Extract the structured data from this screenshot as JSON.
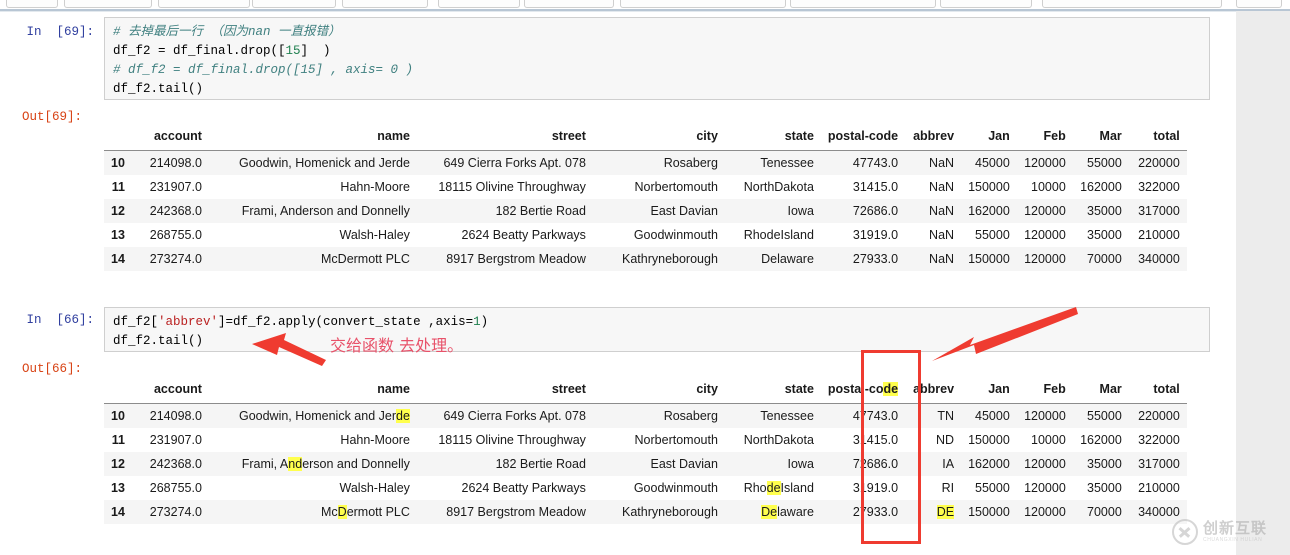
{
  "toolbar": {
    "label": "jupyter-toolbar-sliver"
  },
  "cells": [
    {
      "prompt_in": "In  [69]:",
      "prompt_out": "Out[69]:",
      "code_lines": [
        {
          "segments": [
            {
              "text": "# 去掉最后一行 （因为nan 一直报错）",
              "style": "cmt"
            }
          ]
        },
        {
          "segments": [
            {
              "text": "df_f2 = df_final.drop([",
              "style": ""
            },
            {
              "text": "15",
              "style": "num"
            },
            {
              "text": "]  )",
              "style": ""
            }
          ]
        },
        {
          "segments": [
            {
              "text": "# df_f2 = df_final.drop([15] , axis= 0 )",
              "style": "cmt"
            }
          ]
        },
        {
          "segments": [
            {
              "text": "df_f2.tail()",
              "style": ""
            }
          ]
        }
      ]
    },
    {
      "prompt_in": "In  [66]:",
      "prompt_out": "Out[66]:",
      "code_lines": [
        {
          "segments": [
            {
              "text": "df_f2[",
              "style": ""
            },
            {
              "text": "'abbrev'",
              "style": "str"
            },
            {
              "text": "]=df_f2.apply(convert_state ,axis=",
              "style": ""
            },
            {
              "text": "1",
              "style": "num"
            },
            {
              "text": ")",
              "style": ""
            }
          ]
        },
        {
          "segments": [
            {
              "text": "df_f2.tail()",
              "style": ""
            }
          ]
        }
      ]
    }
  ],
  "table": {
    "headers": [
      "",
      "account",
      "name",
      "street",
      "city",
      "state",
      "postal-code",
      "abbrev",
      "Jan",
      "Feb",
      "Mar",
      "total"
    ],
    "header_postal_code_plain": "postal-co",
    "header_postal_code_hl": "de",
    "rows": [
      {
        "index": "10",
        "account": "214098.0",
        "name": "Goodwin, Homenick and Jerde",
        "name_plain": "Goodwin, Homenick and Jer",
        "name_hl": "de",
        "name_tail": "",
        "street": "649 Cierra Forks Apt. 078",
        "city": "Rosaberg",
        "state": "Tenessee",
        "state_plain": "Tenessee",
        "state_hl": "",
        "state_tail": "",
        "postal_code": "47743.0",
        "abbrev_before": "NaN",
        "abbrev_after": "TN",
        "abbrev_hl": false,
        "jan": "45000",
        "feb": "120000",
        "mar": "55000",
        "total": "220000"
      },
      {
        "index": "11",
        "account": "231907.0",
        "name": "Hahn-Moore",
        "name_plain": "Hahn-Moore",
        "name_hl": "",
        "name_tail": "",
        "street": "18115 Olivine Throughway",
        "city": "Norbertomouth",
        "state": "NorthDakota",
        "state_plain": "NorthDakota",
        "state_hl": "",
        "state_tail": "",
        "postal_code": "31415.0",
        "abbrev_before": "NaN",
        "abbrev_after": "ND",
        "abbrev_hl": false,
        "jan": "150000",
        "feb": "10000",
        "mar": "162000",
        "total": "322000"
      },
      {
        "index": "12",
        "account": "242368.0",
        "name": "Frami, Anderson and Donnelly",
        "name_plain": "Frami, A",
        "name_hl": "nd",
        "name_tail": "erson and Donnelly",
        "street": "182 Bertie Road",
        "city": "East Davian",
        "state": "Iowa",
        "state_plain": "Iowa",
        "state_hl": "",
        "state_tail": "",
        "postal_code": "72686.0",
        "abbrev_before": "NaN",
        "abbrev_after": "IA",
        "abbrev_hl": false,
        "jan": "162000",
        "feb": "120000",
        "mar": "35000",
        "total": "317000"
      },
      {
        "index": "13",
        "account": "268755.0",
        "name": "Walsh-Haley",
        "name_plain": "Walsh-Haley",
        "name_hl": "",
        "name_tail": "",
        "street": "2624 Beatty Parkways",
        "city": "Goodwinmouth",
        "state": "RhodeIsland",
        "state_plain": "Rho",
        "state_hl": "de",
        "state_tail": "Island",
        "postal_code": "31919.0",
        "abbrev_before": "NaN",
        "abbrev_after": "RI",
        "abbrev_hl": false,
        "jan": "55000",
        "feb": "120000",
        "mar": "35000",
        "total": "210000"
      },
      {
        "index": "14",
        "account": "273274.0",
        "name": "McDermott PLC",
        "name_plain": "Mc",
        "name_hl": "D",
        "name_tail": "ermott PLC",
        "street": "8917 Bergstrom Meadow",
        "city": "Kathryneborough",
        "state": "Delaware",
        "state_plain": "",
        "state_hl": "De",
        "state_tail": "laware",
        "postal_code": "27933.0",
        "abbrev_before": "NaN",
        "abbrev_after": "DE",
        "abbrev_hl": true,
        "jan": "150000",
        "feb": "120000",
        "mar": "70000",
        "total": "340000"
      }
    ]
  },
  "annotations": {
    "note_text": "交给函数 去处理。",
    "arrow_color": "#ef3b30",
    "box_color": "#ef3b30",
    "highlight_color": "#ffff4d"
  },
  "watermark": {
    "cn": "创新互联",
    "en": "CHUANGXIN HULIAN"
  }
}
